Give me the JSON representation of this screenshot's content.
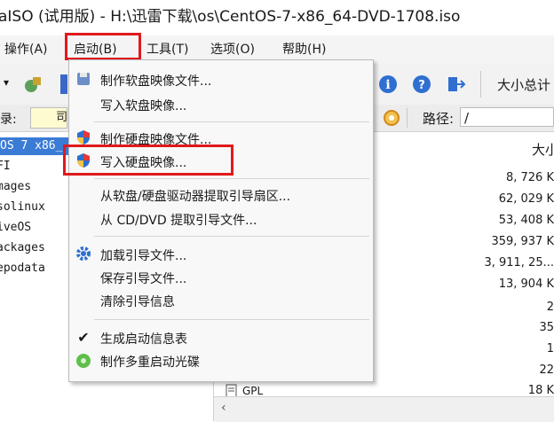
{
  "title": "aISO (试用版) - H:\\迅雷下载\\os\\CentOS-7-x86_64-DVD-1708.iso",
  "menu": {
    "operate": "操作(A)",
    "boot": "启动(B)",
    "tools": "工具(T)",
    "options": "选项(O)",
    "help": "帮助(H)"
  },
  "toolbar": {
    "size_total": "大小总计"
  },
  "address": {
    "left_label": "录:",
    "left_value": "司",
    "path_label": "路径:",
    "path_value": "/"
  },
  "tree": {
    "selected": "OS 7 x86_",
    "items": [
      "FI",
      "mages",
      "solinux",
      "iveOS",
      "ackages",
      "epodata"
    ]
  },
  "list": {
    "size_header": "大小",
    "sizes": [
      "8, 726 K",
      "62, 029 K",
      "53, 408 K",
      "359, 937 K",
      "3, 911, 25...",
      "13, 904 K",
      "2",
      "35",
      "1",
      "22",
      "18 K"
    ],
    "visible_file": "GPL"
  },
  "dropdown": {
    "items": [
      "制作软盘映像文件...",
      "写入软盘映像...",
      "制作硬盘映像文件...",
      "写入硬盘映像...",
      "从软盘/硬盘驱动器提取引导扇区...",
      "从 CD/DVD 提取引导文件...",
      "加载引导文件...",
      "保存引导文件...",
      "清除引导信息",
      "生成启动信息表",
      "制作多重启动光碟"
    ]
  },
  "colors": {
    "highlight_red": "#e0191c",
    "selection_blue": "#3a7bd5"
  }
}
